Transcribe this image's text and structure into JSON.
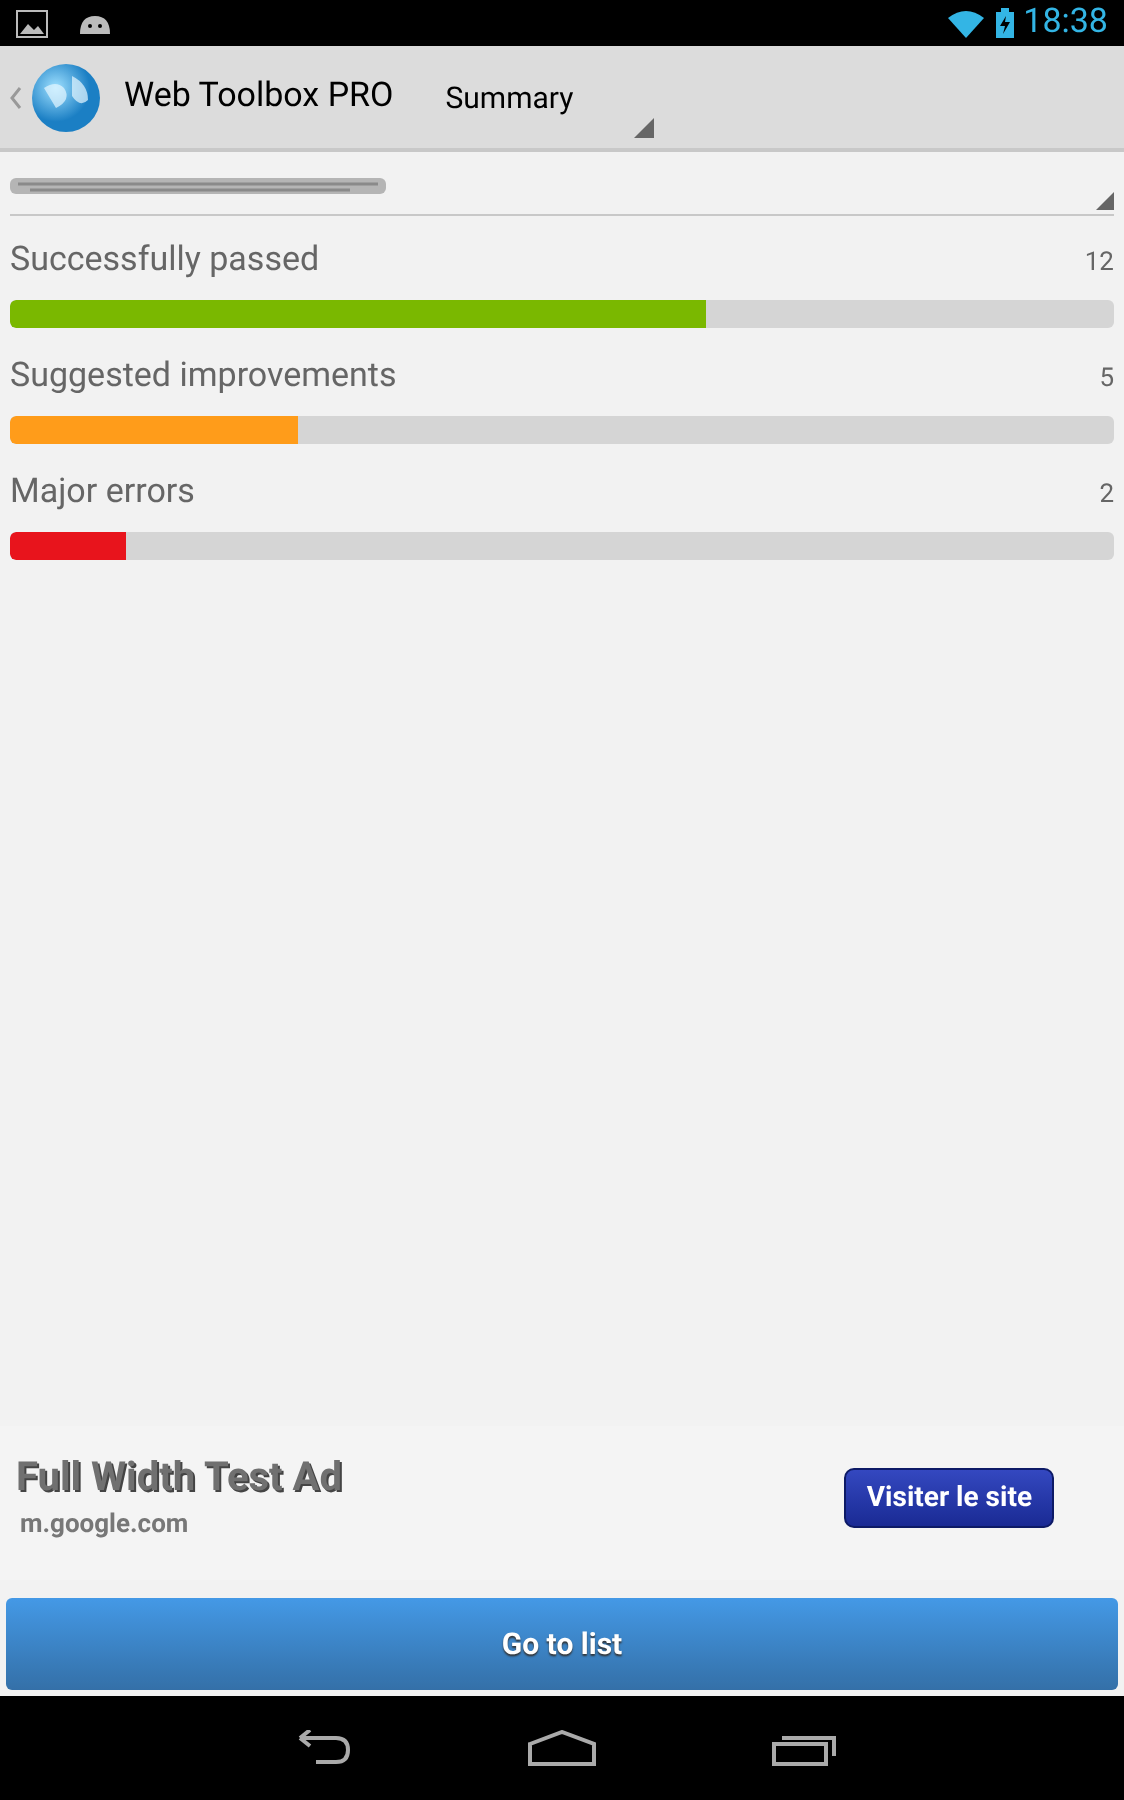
{
  "status_bar": {
    "time": "18:38"
  },
  "action_bar": {
    "title": "Web Toolbox PRO",
    "spinner": "Summary"
  },
  "results": [
    {
      "label": "Successfully passed",
      "count": "12",
      "level": 0.63,
      "color": "#7ab800"
    },
    {
      "label": "Suggested improvements",
      "count": "5",
      "level": 0.26,
      "color": "#ff9c1a"
    },
    {
      "label": "Major errors",
      "count": "2",
      "level": 0.105,
      "color": "#e8141c"
    }
  ],
  "ad": {
    "title": "Full Width Test Ad",
    "url": "m.google.com",
    "button": "Visiter le site"
  },
  "button": "Go to list"
}
